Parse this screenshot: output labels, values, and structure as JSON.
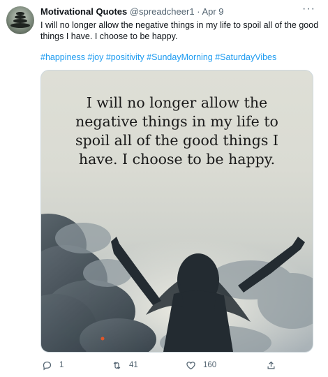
{
  "tweet": {
    "author_name": "Motivational Quotes",
    "handle": "@spreadcheer1",
    "separator": "·",
    "date": "Apr 9",
    "more": "···",
    "text": "I will no longer allow the negative things in my life to spoil all of the good things I have. I choose to be happy.",
    "hashtags": [
      "#happiness",
      "#joy",
      "#positivity",
      "#SundayMorning",
      "#SaturdayVibes"
    ],
    "image_quote": [
      "I will no longer allow the",
      "negative things in my life to",
      "spoil all of the good things I",
      "have. I choose to be happy."
    ],
    "replies": "1",
    "retweets": "41",
    "likes": "160"
  },
  "icons": [
    "avatar",
    "more-icon",
    "reply-icon",
    "retweet-icon",
    "like-icon",
    "share-icon"
  ],
  "colors": {
    "link": "#1d9bf0",
    "muted": "#536471",
    "text": "#0f1419"
  }
}
